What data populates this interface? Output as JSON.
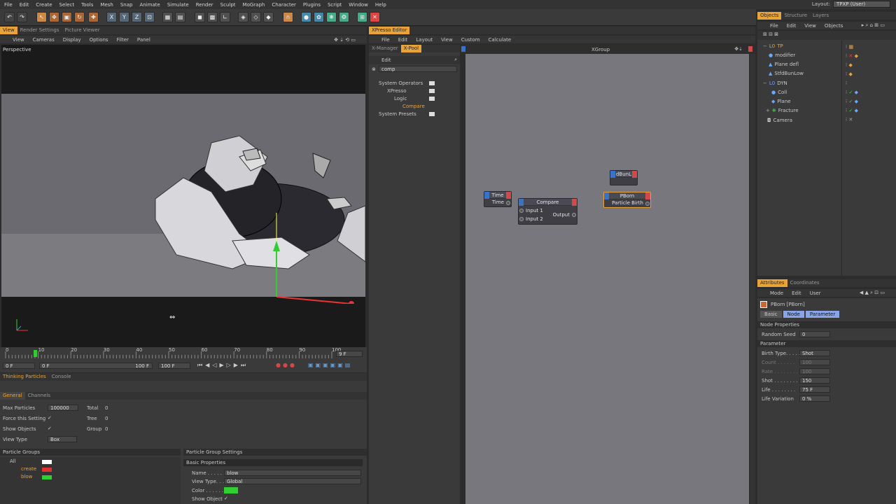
{
  "menubar": {
    "items": [
      "File",
      "Edit",
      "Create",
      "Select",
      "Tools",
      "Mesh",
      "Snap",
      "Animate",
      "Simulate",
      "Render",
      "Sculpt",
      "MoGraph",
      "Character",
      "Plugins",
      "Script",
      "Window",
      "Help"
    ],
    "layout_label": "Layout:",
    "layout_value": "TPXP (User)"
  },
  "viewport": {
    "tabs": [
      "View",
      "Render Settings",
      "Picture Viewer"
    ],
    "menu": [
      "View",
      "Cameras",
      "Display",
      "Options",
      "Filter",
      "Panel"
    ],
    "label": "Perspective"
  },
  "timeline": {
    "ticks": [
      "0",
      "10",
      "20",
      "30",
      "40",
      "50",
      "60",
      "70",
      "80",
      "90",
      "100"
    ],
    "frame_display": "9 F",
    "start_field": "0 F",
    "end_field_1": "100 F",
    "end_field_2": "100 F",
    "inner_start": "0 F",
    "current_frame_fraction": 0.09
  },
  "thinking_particles": {
    "tabs": [
      "Thinking Particles",
      "Console"
    ],
    "subtabs": [
      "General",
      "Channels"
    ],
    "max_particles_label": "Max Particles",
    "max_particles_value": "100000",
    "total_label": "Total",
    "total_value": "0",
    "force_label": "Force this Setting",
    "tree_label": "Tree",
    "tree_value": "0",
    "show_objects_label": "Show Objects",
    "group_label": "Group",
    "group_value": "0",
    "view_type_label": "View Type",
    "view_type_value": "Box",
    "check": "✓",
    "particle_groups_title": "Particle Groups",
    "groups": [
      {
        "name": "All",
        "color": "#ffffff"
      },
      {
        "name": "create",
        "color": "#e03030"
      },
      {
        "name": "blow",
        "color": "#30d030"
      }
    ],
    "pgs_title": "Particle Group Settings",
    "basic_props_title": "Basic Properties",
    "name_label": "Name . . . . . . . .",
    "name_value": "blow",
    "view_type2_label": "View Type. . . . .",
    "view_type2_value": "Global",
    "color_label": "Color . . . . . . . .",
    "show_object_label": "Show Object"
  },
  "xpresso": {
    "title": "XPresso Editor",
    "menu": [
      "File",
      "Edit",
      "Layout",
      "View",
      "Custom",
      "Calculate"
    ],
    "pool_tabs": [
      "X-Manager",
      "X-Pool"
    ],
    "edit_label": "Edit",
    "search_value": "comp",
    "tree": [
      {
        "label": "System Operators",
        "indent": 0,
        "highlight": false
      },
      {
        "label": "XPresso",
        "indent": 1,
        "highlight": false
      },
      {
        "label": "Logic",
        "indent": 2,
        "highlight": false
      },
      {
        "label": "Compare",
        "indent": 3,
        "highlight": true
      },
      {
        "label": "System Presets",
        "indent": 0,
        "highlight": false
      }
    ],
    "group_title": "XGroup",
    "nodes": {
      "time": {
        "title": "Time",
        "out": "Time"
      },
      "compare": {
        "title": "Compare",
        "in1": "Input 1",
        "in2": "Input 2",
        "out": "Output"
      },
      "dbun": {
        "title": "dBunL"
      },
      "pborn": {
        "title": "PBorn",
        "out": "Particle Birth"
      }
    }
  },
  "objects": {
    "tabs": [
      "Objects",
      "Structure",
      "Layers"
    ],
    "menu": [
      "File",
      "Edit",
      "View",
      "Objects"
    ],
    "items": [
      {
        "name": "TP",
        "indent": 0,
        "icon": "null-icon"
      },
      {
        "name": "modifier",
        "indent": 1,
        "icon": "modifier-icon"
      },
      {
        "name": "Plane defl",
        "indent": 1,
        "icon": "deflector-icon"
      },
      {
        "name": "StfdBunLow",
        "indent": 1,
        "icon": "mesh-icon"
      },
      {
        "name": "DYN",
        "indent": 0,
        "icon": "null-icon"
      },
      {
        "name": "Coll",
        "indent": 1,
        "icon": "sphere-icon"
      },
      {
        "name": "Plane",
        "indent": 1,
        "icon": "plane-icon"
      },
      {
        "name": "Fracture",
        "indent": 1,
        "icon": "fracture-icon"
      },
      {
        "name": "Camera",
        "indent": 0,
        "icon": "camera-icon"
      }
    ]
  },
  "attributes": {
    "tabs": [
      "Attributes",
      "Coordinates"
    ],
    "menu": [
      "Mode",
      "Edit",
      "User"
    ],
    "object_title": "PBorn [PBorn]",
    "subtabs": [
      "Basic",
      "Node",
      "Parameter"
    ],
    "node_props_title": "Node Properties",
    "random_seed_label": "Random Seed",
    "random_seed_value": "0",
    "parameter_title": "Parameter",
    "birth_type_label": "Birth Type. . . . .",
    "birth_type_value": "Shot",
    "count_label": "Count . . . . . .",
    "count_value": "100",
    "rate_label": "Rate . . . . . . . .",
    "rate_value": "100",
    "shot_label": "Shot . . . . . . . .",
    "shot_value": "150",
    "life_label": "Life . . . . . . . .",
    "life_value": "75 F",
    "life_var_label": "Life Variation",
    "life_var_value": "0 %"
  },
  "colors": {
    "accent": "#e8a43a",
    "blue_port": "#3a72c8",
    "red_port": "#d04a4a",
    "canvas": "#78777d"
  }
}
